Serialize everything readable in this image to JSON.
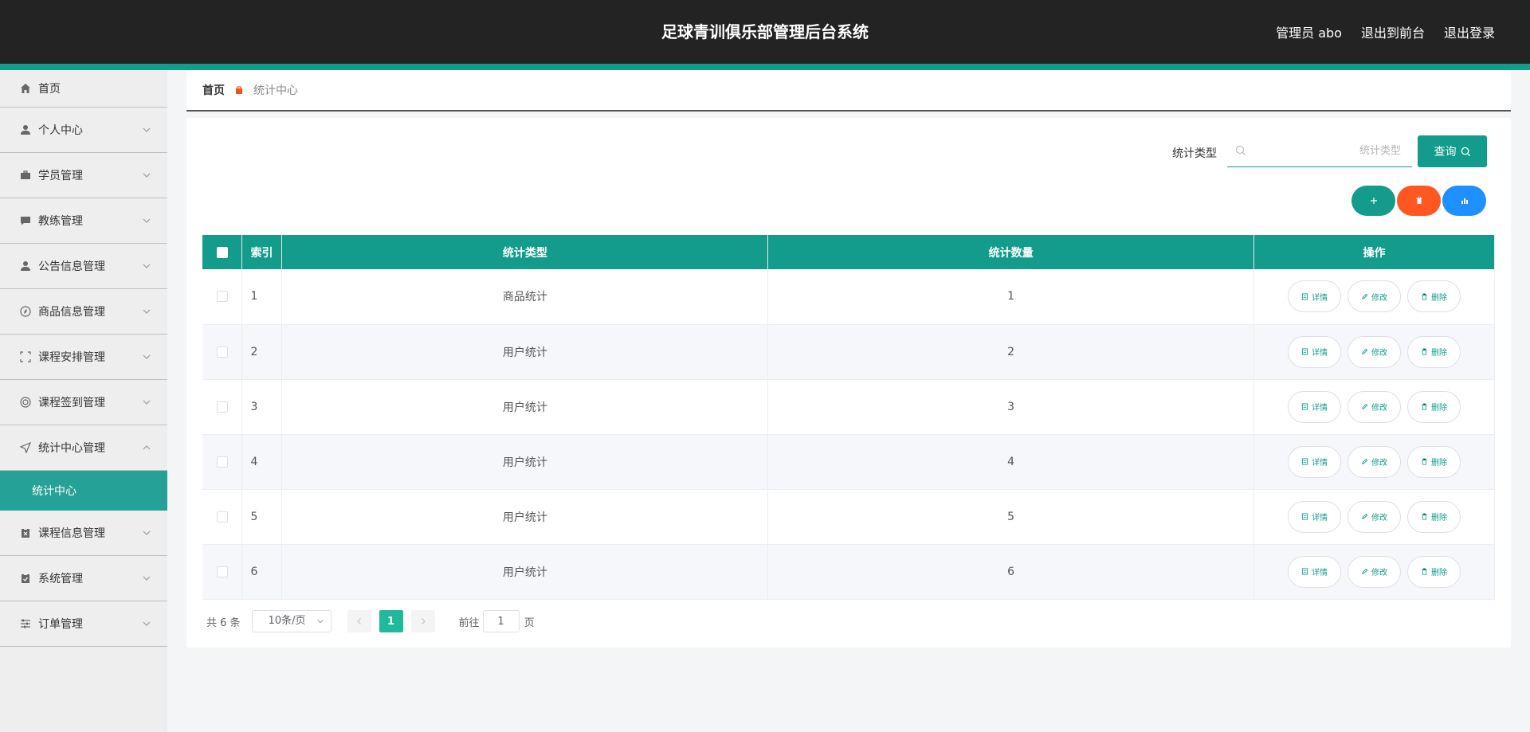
{
  "header": {
    "title": "足球青训俱乐部管理后台系统",
    "user": "管理员 abo",
    "to_front": "退出到前台",
    "logout": "退出登录"
  },
  "sidebar": {
    "items": [
      {
        "label": "首页",
        "icon": "home-icon"
      },
      {
        "label": "个人中心",
        "icon": "user-icon"
      },
      {
        "label": "学员管理",
        "icon": "briefcase-icon"
      },
      {
        "label": "教练管理",
        "icon": "chat-icon"
      },
      {
        "label": "公告信息管理",
        "icon": "user-icon"
      },
      {
        "label": "商品信息管理",
        "icon": "compass-icon"
      },
      {
        "label": "课程安排管理",
        "icon": "fullscreen-icon"
      },
      {
        "label": "课程签到管理",
        "icon": "lifebuoy-icon"
      },
      {
        "label": "统计中心管理",
        "icon": "send-icon"
      },
      {
        "label": "课程信息管理",
        "icon": "clipboard-icon"
      },
      {
        "label": "系统管理",
        "icon": "clipboard-check-icon"
      },
      {
        "label": "订单管理",
        "icon": "sliders-icon"
      }
    ],
    "active_sub": "统计中心"
  },
  "breadcrumb": {
    "home": "首页",
    "current": "统计中心"
  },
  "search": {
    "label": "统计类型",
    "placeholder": "统计类型",
    "button": "查询"
  },
  "table": {
    "headers": {
      "index": "索引",
      "type": "统计类型",
      "count": "统计数量",
      "ops": "操作"
    },
    "rows": [
      {
        "index": "1",
        "type": "商品统计",
        "count": "1"
      },
      {
        "index": "2",
        "type": "用户统计",
        "count": "2"
      },
      {
        "index": "3",
        "type": "用户统计",
        "count": "3"
      },
      {
        "index": "4",
        "type": "用户统计",
        "count": "4"
      },
      {
        "index": "5",
        "type": "用户统计",
        "count": "5"
      },
      {
        "index": "6",
        "type": "用户统计",
        "count": "6"
      }
    ],
    "ops": {
      "detail": "详情",
      "edit": "修改",
      "delete": "删除"
    }
  },
  "pagination": {
    "total": "共 6 条",
    "page_size": "10条/页",
    "current": "1",
    "goto_label": "前往",
    "goto_value": "1",
    "page_unit": "页"
  },
  "colors": {
    "accent": "#139c8c",
    "danger": "#ff5722",
    "info": "#1e90ff",
    "header_bg": "#232323"
  }
}
